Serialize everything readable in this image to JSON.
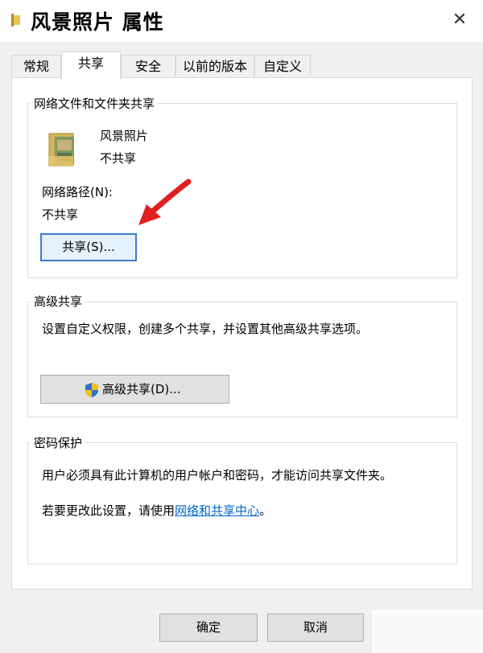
{
  "window": {
    "title": "风景照片 属性",
    "close_glyph": "✕",
    "close_label": "关闭"
  },
  "tabs": [
    {
      "label": "常规"
    },
    {
      "label": "共享"
    },
    {
      "label": "安全"
    },
    {
      "label": "以前的版本"
    },
    {
      "label": "自定义"
    }
  ],
  "network_sharing": {
    "group_title": "网络文件和文件夹共享",
    "folder_name": "风景照片",
    "folder_status": "不共享",
    "path_label": "网络路径(N):",
    "path_value": "不共享",
    "share_button": "共享(S)..."
  },
  "advanced_sharing": {
    "group_title": "高级共享",
    "description": "设置自定义权限，创建多个共享，并设置其他高级共享选项。",
    "button": "高级共享(D)..."
  },
  "password_protection": {
    "group_title": "密码保护",
    "description": "用户必须具有此计算机的用户帐户和密码，才能访问共享文件夹。",
    "change_prefix": "若要更改此设置，请使用",
    "change_link": "网络和共享中心",
    "change_suffix": "。"
  },
  "buttons": {
    "ok": "确定",
    "cancel": "取消"
  },
  "colors": {
    "accent": "#3d7bd2",
    "link": "#0066cc",
    "arrow": "#e02020",
    "folder": "#d6b45a"
  },
  "icons": {
    "title": "folder-icon",
    "folder": "folder-with-photos-icon",
    "advanced": "uac-shield-icon",
    "annotation": "red-arrow-icon"
  }
}
